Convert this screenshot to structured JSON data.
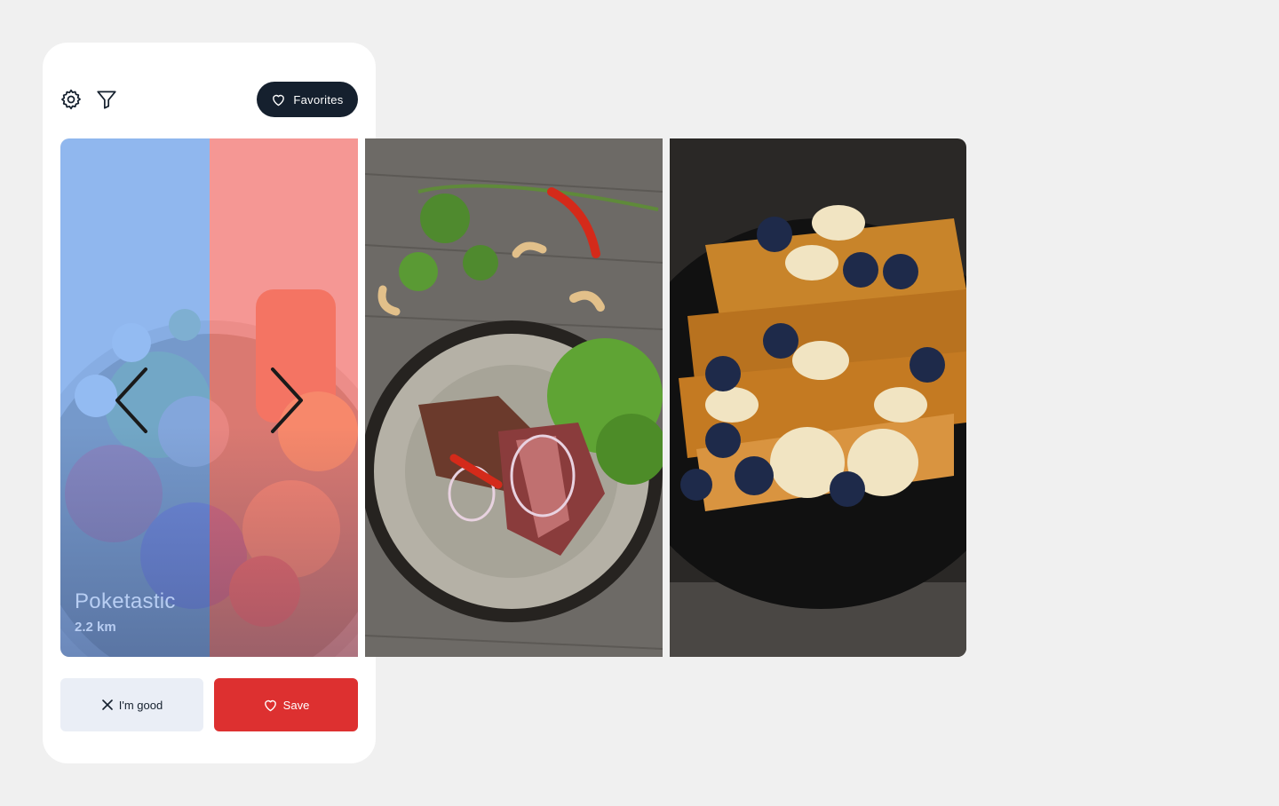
{
  "header": {
    "settings_icon": "gear-icon",
    "filter_icon": "filter-icon",
    "favorites_label": "Favorites",
    "favorites_icon": "heart-icon"
  },
  "cards": [
    {
      "title": "Poketastic",
      "distance": "2.2 km",
      "image": "poke-bowl-photo"
    },
    {
      "image": "steak-salad-photo"
    },
    {
      "image": "french-toast-photo"
    }
  ],
  "navigation": {
    "prev_icon": "chevron-left-icon",
    "next_icon": "chevron-right-icon"
  },
  "actions": {
    "dismiss_label": "I'm good",
    "dismiss_icon": "close-icon",
    "save_label": "Save",
    "save_icon": "heart-icon"
  },
  "colors": {
    "background": "#f0f0f0",
    "panel": "#ffffff",
    "dark_button": "#15202e",
    "save_button": "#dd3030",
    "dismiss_button": "#eaeef6",
    "overlay_left": "#6ea5f5",
    "overlay_right": "#fa7878"
  }
}
